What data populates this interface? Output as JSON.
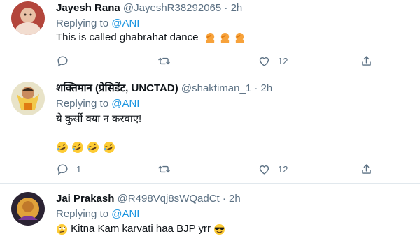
{
  "tweets": [
    {
      "name": "Jayesh Rana",
      "handle": "@JayeshR38292065",
      "dot": "·",
      "time": "2h",
      "replying_prefix": "Replying to ",
      "replying_to": "@ANI",
      "text": "This is called ghabrahat dance",
      "emoji": "person-facepalming x3",
      "reply_count": "",
      "like_count": "12"
    },
    {
      "name": "शक्तिमान (प्रेसिडेंट, UNCTAD)",
      "handle": "@shaktiman_1",
      "dot": "·",
      "time": "2h",
      "replying_prefix": "Replying to ",
      "replying_to": "@ANI",
      "text": "ये कुर्सी क्या न करवाए!",
      "emoji": "rolling-on-floor-laughing x4",
      "reply_count": "1",
      "like_count": "12"
    },
    {
      "name": "Jai Prakash",
      "handle": "@R498Vqj8sWQadCt",
      "dot": "·",
      "time": "2h",
      "replying_prefix": "Replying to ",
      "replying_to": "@ANI",
      "text": "Kitna Kam karvati haa BJP yrr"
    }
  ]
}
